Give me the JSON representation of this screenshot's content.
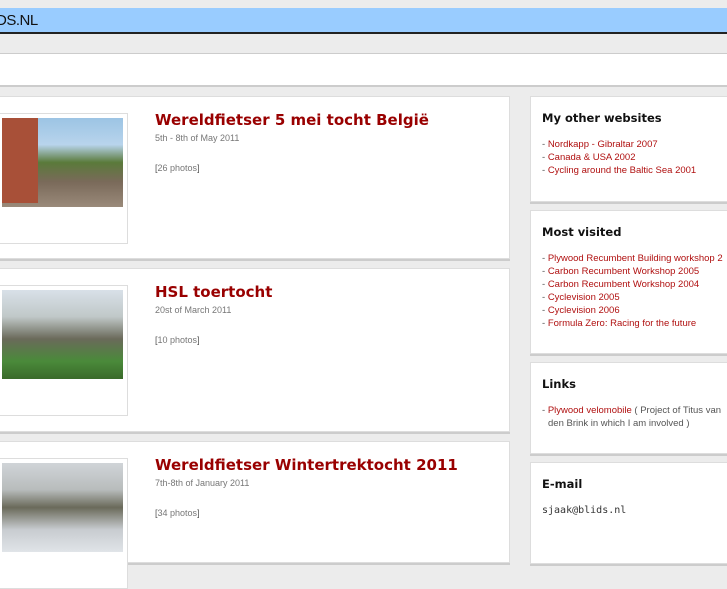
{
  "header": {
    "title": "DS.NL"
  },
  "albums": [
    {
      "title": "Wereldfietser 5 mei tocht België",
      "date": "5th - 8th of May 2011",
      "photos": "26 photos"
    },
    {
      "title": "HSL toertocht",
      "date": "20st of March 2011",
      "photos": "10 photos"
    },
    {
      "title": "Wereldfietser Wintertrektocht 2011",
      "date": "7th-8th of January 2011",
      "photos": "34 photos"
    }
  ],
  "sidebar": {
    "other": {
      "title": "My other websites",
      "items": [
        "Nordkapp - Gibraltar 2007",
        "Canada & USA 2002",
        "Cycling around the Baltic Sea 2001"
      ]
    },
    "most": {
      "title": "Most visited",
      "items": [
        "Plywood Recumbent Building workshop 2",
        "Carbon Recumbent Workshop 2005",
        "Carbon Recumbent Workshop 2004",
        "Cyclevision 2005",
        "Cyclevision 2006",
        "Formula Zero: Racing for the future"
      ]
    },
    "links": {
      "title": "Links",
      "link": "Plywood velomobile",
      "desc": " ( Project of Titus van den Brink in which I am involved )"
    },
    "email": {
      "title": "E-mail",
      "address": "sjaak@blids.nl"
    }
  }
}
